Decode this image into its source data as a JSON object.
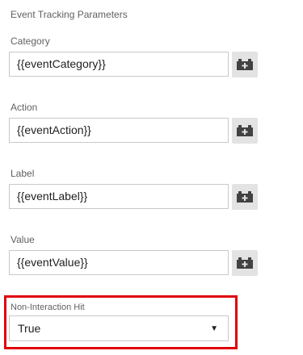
{
  "section_title": "Event Tracking Parameters",
  "fields": [
    {
      "label": "Category",
      "value": "{{eventCategory}}",
      "button_icon": "variable-brick-icon"
    },
    {
      "label": "Action",
      "value": "{{eventAction}}",
      "button_icon": "variable-brick-icon"
    },
    {
      "label": "Label",
      "value": "{{eventLabel}}",
      "button_icon": "variable-brick-icon"
    },
    {
      "label": "Value",
      "value": "{{eventValue}}",
      "button_icon": "variable-brick-icon"
    }
  ],
  "non_interaction": {
    "label": "Non-Interaction Hit",
    "selected": "True",
    "highlight_color": "#e0000b"
  }
}
